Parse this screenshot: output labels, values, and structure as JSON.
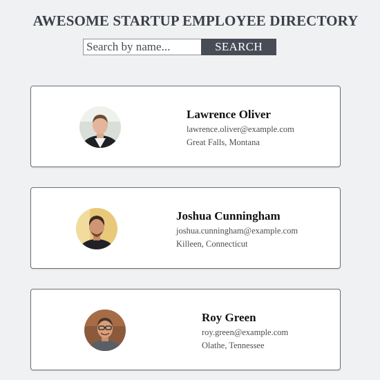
{
  "header": {
    "title": "AWESOME STARTUP EMPLOYEE DIRECTORY"
  },
  "search": {
    "placeholder": "Search by name...",
    "value": "",
    "button_label": "SEARCH"
  },
  "employees": [
    {
      "name": "Lawrence Oliver",
      "email": "lawrence.oliver@example.com",
      "location": "Great Falls, Montana",
      "avatar_icon": "user-photo-avatar"
    },
    {
      "name": "Joshua Cunningham",
      "email": "joshua.cunningham@example.com",
      "location": "Killeen, Connecticut",
      "avatar_icon": "user-photo-avatar"
    },
    {
      "name": "Roy Green",
      "email": "roy.green@example.com",
      "location": "Olathe, Tennessee",
      "avatar_icon": "user-photo-avatar"
    }
  ],
  "colors": {
    "page_background": "#f0f1f3",
    "title_text": "#3c4048",
    "button_background": "#474c56",
    "button_text": "#ffffff",
    "card_background": "#ffffff",
    "card_border": "#6b6f76"
  }
}
